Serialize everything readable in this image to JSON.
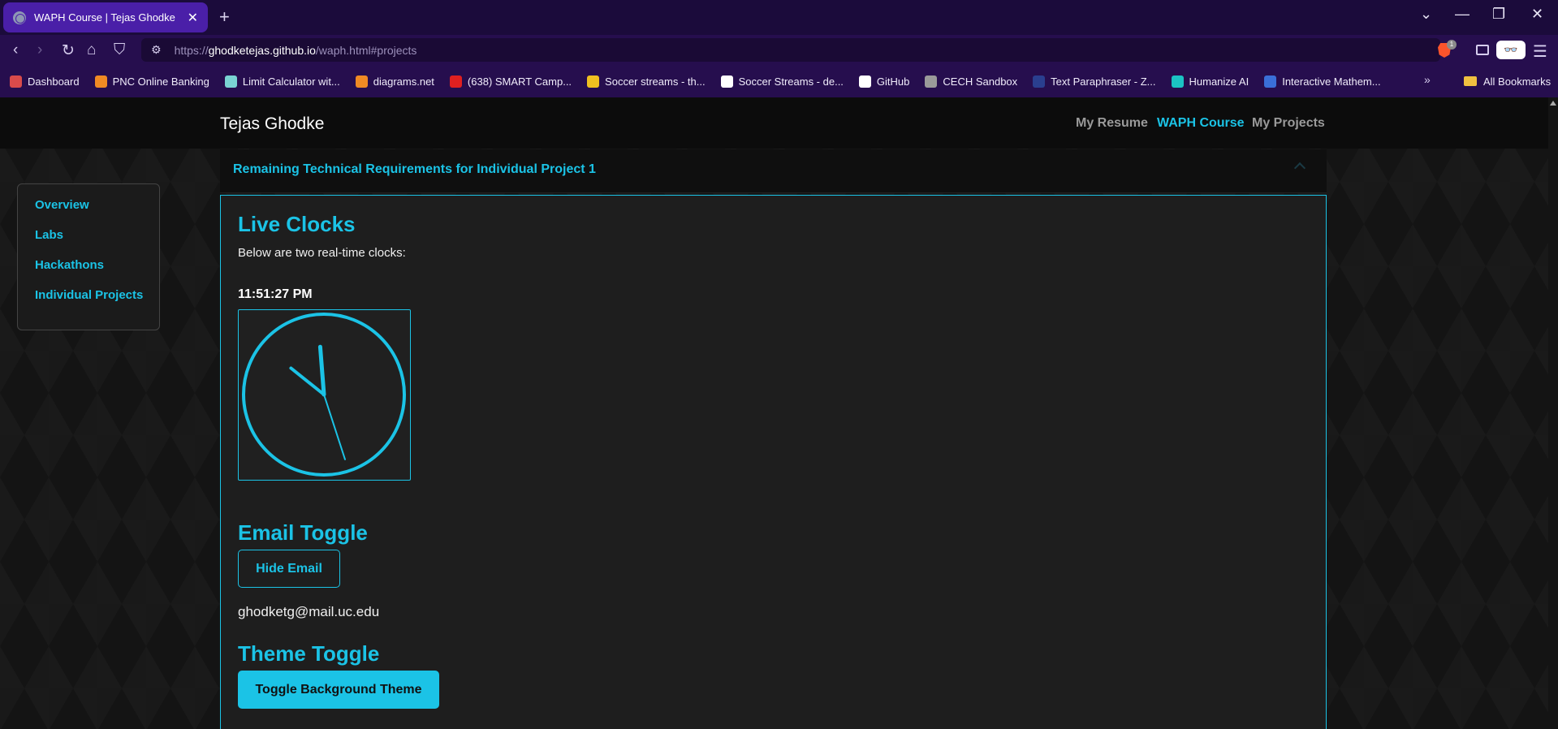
{
  "browser": {
    "tab_title": "WAPH Course | Tejas Ghodke",
    "url_scheme": "https://",
    "url_host": "ghodketejas.github.io",
    "url_path": "/waph.html#projects",
    "brave_badge": "1",
    "bookmarks": [
      {
        "label": "Dashboard",
        "color": "#d94b4b"
      },
      {
        "label": "PNC Online Banking",
        "color": "#f08a24"
      },
      {
        "label": "Limit Calculator wit...",
        "color": "#7ad3d3"
      },
      {
        "label": "diagrams.net",
        "color": "#f08a24"
      },
      {
        "label": "(638) SMART Camp...",
        "color": "#e02020"
      },
      {
        "label": "Soccer streams - th...",
        "color": "#f0c020"
      },
      {
        "label": "Soccer Streams - de...",
        "color": "#ffffff"
      },
      {
        "label": "GitHub",
        "color": "#ffffff"
      },
      {
        "label": "CECH Sandbox",
        "color": "#9a9a9a"
      },
      {
        "label": "Text Paraphraser - Z...",
        "color": "#2a3f8f"
      },
      {
        "label": "Humanize AI",
        "color": "#1bc3c3"
      },
      {
        "label": "Interactive Mathem...",
        "color": "#3a6fd8"
      }
    ],
    "all_bookmarks": "All Bookmarks"
  },
  "site": {
    "brand": "Tejas Ghodke",
    "nav": [
      "My Resume",
      "WAPH Course",
      "My Projects"
    ],
    "active_nav": "WAPH Course"
  },
  "sidebar": {
    "items": [
      "Overview",
      "Labs",
      "Hackathons",
      "Individual Projects"
    ]
  },
  "accordion": {
    "title": "Remaining Technical Requirements for Individual Project 1"
  },
  "content": {
    "clocks_heading": "Live Clocks",
    "clocks_desc": "Below are two real-time clocks:",
    "digital_time": "11:51:27 PM",
    "analog_time": {
      "hour": 11,
      "minute": 51,
      "second": 27
    },
    "email_heading": "Email Toggle",
    "email_button": "Hide Email",
    "email": "ghodketg@mail.uc.edu",
    "theme_heading": "Theme Toggle",
    "theme_button": "Toggle Background Theme"
  },
  "colors": {
    "accent": "#1bc3e6",
    "tab_active": "#4a1fa8",
    "chrome_bg": "#260e4e"
  }
}
